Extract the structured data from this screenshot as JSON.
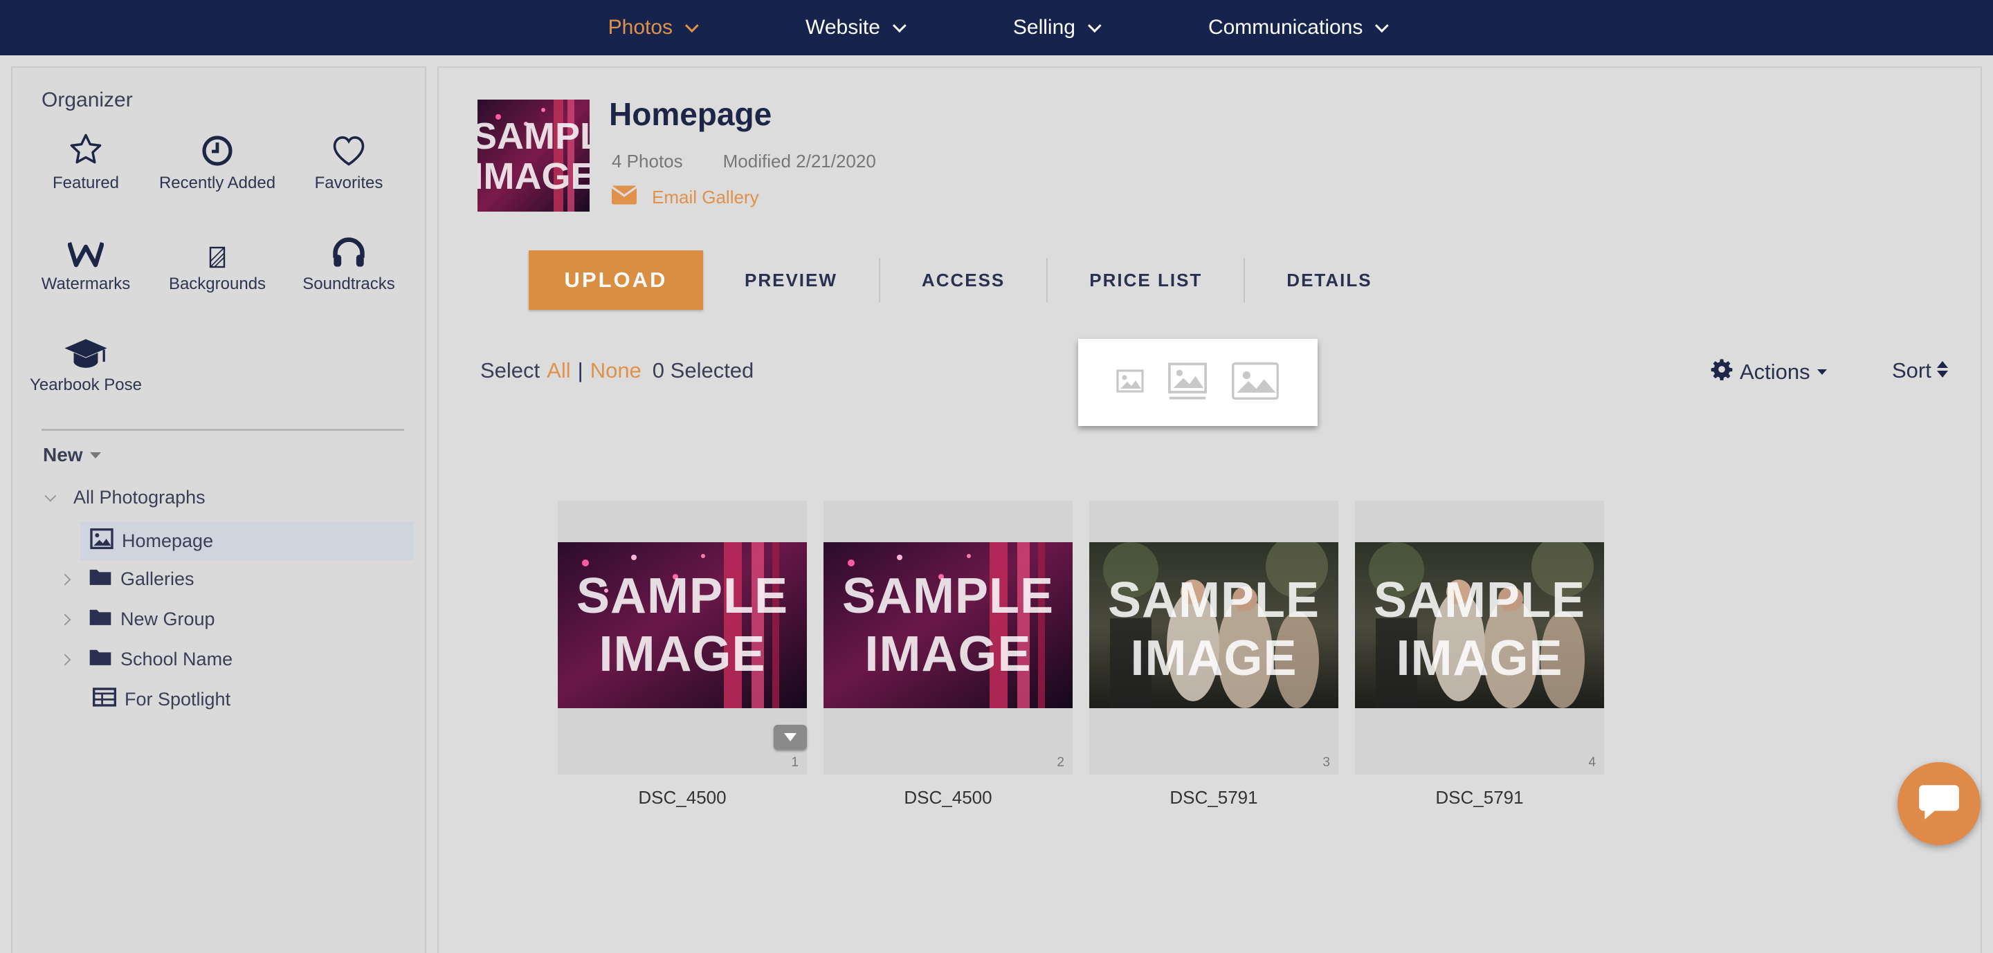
{
  "nav": {
    "items": [
      {
        "label": "Photos",
        "active": true
      },
      {
        "label": "Website",
        "active": false
      },
      {
        "label": "Selling",
        "active": false
      },
      {
        "label": "Communications",
        "active": false
      }
    ]
  },
  "sidebar": {
    "title": "Organizer",
    "items": [
      {
        "label": "Featured",
        "icon": "star-icon"
      },
      {
        "label": "Recently Added",
        "icon": "clock-icon"
      },
      {
        "label": "Favorites",
        "icon": "heart-icon"
      },
      {
        "label": "Watermarks",
        "icon": "watermark-w-icon"
      },
      {
        "label": "Backgrounds",
        "icon": "background-icon"
      },
      {
        "label": "Soundtracks",
        "icon": "headphones-icon"
      },
      {
        "label": "Yearbook Pose",
        "icon": "graduation-cap-icon"
      }
    ],
    "new_label": "New",
    "tree": [
      {
        "label": "All Photographs",
        "icon": "chevron-down-icon"
      },
      {
        "label": "Homepage",
        "icon": "image-icon",
        "selected": true
      },
      {
        "label": "Galleries",
        "icon": "folder-icon"
      },
      {
        "label": "New Group",
        "icon": "folder-icon"
      },
      {
        "label": "School Name",
        "icon": "folder-icon"
      },
      {
        "label": "For Spotlight",
        "icon": "table-icon"
      }
    ]
  },
  "gallery": {
    "title": "Homepage",
    "photo_count": "4 Photos",
    "modified": "Modified 2/21/2020",
    "email_label": "Email Gallery",
    "cover_text": [
      "SAMPL",
      "IMAGE"
    ]
  },
  "toolbar": {
    "upload": "UPLOAD",
    "preview": "PREVIEW",
    "access": "ACCESS",
    "price_list": "PRICE LIST",
    "details": "DETAILS"
  },
  "selection": {
    "select_label": "Select",
    "all": "All",
    "separator": "|",
    "none": "None",
    "selected": "0 Selected"
  },
  "actions_label": "Actions",
  "sort_label": "Sort",
  "photos": [
    {
      "name": "DSC_4500",
      "index": "1",
      "style": "party",
      "text1": "SAMPLE",
      "text2": "IMAGE"
    },
    {
      "name": "DSC_4500",
      "index": "2",
      "style": "party",
      "text1": "SAMPLE",
      "text2": "IMAGE"
    },
    {
      "name": "DSC_5791",
      "index": "3",
      "style": "wedding",
      "text1": "SAMPLE",
      "text2": "IMAGE"
    },
    {
      "name": "DSC_5791",
      "index": "4",
      "style": "wedding",
      "text1": "SAMPLE",
      "text2": "IMAGE"
    }
  ],
  "colors": {
    "nav_bg": "#16234d",
    "accent": "#e0914a",
    "upload_bg": "#d98e42"
  }
}
